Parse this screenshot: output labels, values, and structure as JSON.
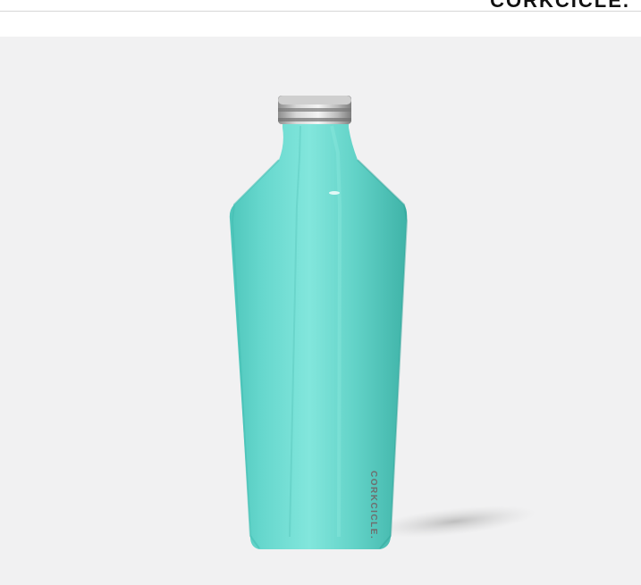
{
  "header": {
    "brand_logo_text": "CORKCICLE."
  },
  "product": {
    "bottle_color": "#6fe0d6",
    "background_color": "#f1f1f2",
    "cap_color": "#b9b9b9",
    "bottle_label": "CORKCICLE."
  }
}
